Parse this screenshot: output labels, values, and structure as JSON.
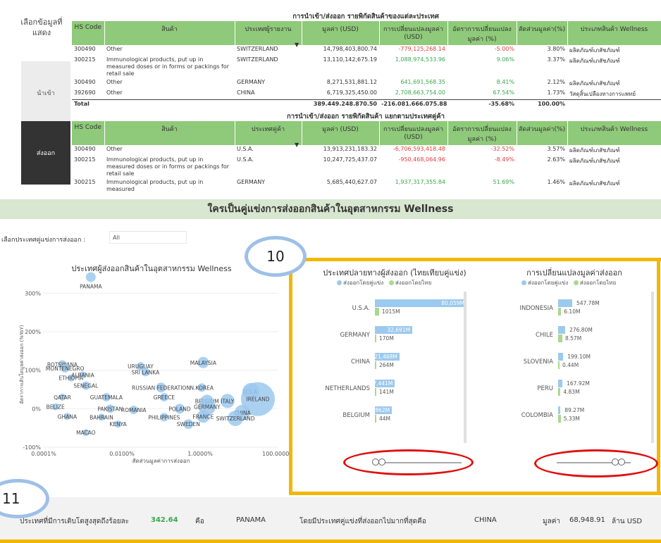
{
  "selector": {
    "title": "เลือกข้อมูลที่แสดง",
    "import_label": "นำเข้า",
    "export_label": "ส่งออก"
  },
  "table1": {
    "title": "การนำเข้า/ส่งออก รายพิกัดสินค้าของแต่ละประเทศ",
    "headers": [
      "HS Code",
      "สินค้า",
      "ประเทศผู้รายงาน",
      "มูลค่า (USD)",
      "การเปลี่ยนแปลงมูลค่า (USD)",
      "อัตราการเปลี่ยนแปลงมูลค่า (%)",
      "สัดส่วนมูลค่า(%)",
      "ประเภทสินค้า Wellness"
    ],
    "rows": [
      [
        "300490",
        "Other",
        "SWITZERLAND",
        "14,798,403,800.74",
        "-779,125,268.14",
        "-5.00%",
        "3.80%",
        "ผลิตภัณฑ์เภสัชภัณฑ์"
      ],
      [
        "300215",
        "Immunological products, put up in measured doses or in forms or packings for retail sale",
        "SWITZERLAND",
        "13,110,142,675.19",
        "1,088,974,533.96",
        "9.06%",
        "3.37%",
        "ผลิตภัณฑ์เภสัชภัณฑ์"
      ],
      [
        "300490",
        "Other",
        "GERMANY",
        "8,271,531,881.12",
        "641,691,568.35",
        "8.41%",
        "2.12%",
        "ผลิตภัณฑ์เภสัชภัณฑ์"
      ],
      [
        "392690",
        "Other",
        "CHINA",
        "6,719,325,450.00",
        "2,708,663,754.00",
        "67.54%",
        "1.73%",
        "วัสดุสิ้นเปลืองทางการแพทย์"
      ]
    ],
    "total": [
      "Total",
      "",
      "",
      "389,449,248,870.50",
      "-216,081,666,075.88",
      "-35.68%",
      "100.00%",
      ""
    ]
  },
  "table2": {
    "title": "การนำเข้า/ส่งออก รายพิกัดสินค้า แยกตามประเทศคู่ค้า",
    "headers": [
      "HS Code",
      "สินค้า",
      "ประเทศคู่ค้า",
      "มูลค่า (USD)",
      "การเปลี่ยนแปลงมูลค่า (USD)",
      "อัตราการเปลี่ยนแปลงมูลค่า (%)",
      "สัดส่วนมูลค่า(%)",
      "ประเภทสินค้า Wellness"
    ],
    "rows": [
      [
        "300490",
        "Other",
        "U.S.A.",
        "13,913,231,183.32",
        "-6,706,593,418.48",
        "-32.52%",
        "3.57%",
        "ผลิตภัณฑ์เภสัชภัณฑ์"
      ],
      [
        "300215",
        "Immunological products, put up in measured doses or in forms or packings for retail sale",
        "U.S.A.",
        "10,247,725,437.07",
        "-950,468,064.96",
        "-8.49%",
        "2.63%",
        "ผลิตภัณฑ์เภสัชภัณฑ์"
      ],
      [
        "300215",
        "Immunological products, put up in measured",
        "GERMANY",
        "5,685,440,627.07",
        "1,937,317,355.84",
        "51.69%",
        "1.46%",
        "ผลิตภัณฑ์เภสัชภัณฑ์"
      ]
    ],
    "total": [
      "Total",
      "",
      "",
      "389,449,248,870.49",
      "-216,081,666,075.89",
      "-35.68%",
      "100.00%",
      ""
    ]
  },
  "banner": "ใครเป็นคู่แข่งการส่งออกสินค้าในอุตสาหกรรม Wellness",
  "filter": {
    "label": "เลือกประเทศคู่แข่งการส่งออก :",
    "value": "All"
  },
  "badges": {
    "b10": "10",
    "b11": "11"
  },
  "scatter": {
    "title": "ประเทศผู้ส่งออกสินค้าในอุตสาหกรรม Wellness",
    "xlabel": "สัดส่วนมูลค่าการส่งออก",
    "ylabel": "อัตราการเติบโตมูลค่าส่งออก (%YoY)",
    "yticks": [
      "300%",
      "200%",
      "100%",
      "0%",
      "-100%"
    ],
    "xticks": [
      "0.0001%",
      "0.0100%",
      "1.0000%",
      "100.0000%"
    ],
    "points": [
      {
        "label": "PANAMA",
        "x": 0.0016,
        "y": 342,
        "r": 7
      },
      {
        "label": "BOTSWANA",
        "x": 0.0003,
        "y": 115,
        "r": 6
      },
      {
        "label": "MONTENEGRO",
        "x": 0.00035,
        "y": 105,
        "r": 6
      },
      {
        "label": "ETHIOPIA",
        "x": 0.0005,
        "y": 80,
        "r": 5
      },
      {
        "label": "ALBANIA",
        "x": 0.001,
        "y": 88,
        "r": 5
      },
      {
        "label": "URUGUAY",
        "x": 0.03,
        "y": 110,
        "r": 6
      },
      {
        "label": "SRI LANKA",
        "x": 0.04,
        "y": 95,
        "r": 6
      },
      {
        "label": "MALAYSIA",
        "x": 1.2,
        "y": 120,
        "r": 8
      },
      {
        "label": "SENEGAL",
        "x": 0.0012,
        "y": 60,
        "r": 6
      },
      {
        "label": "RUSSIAN FEDERATION",
        "x": 0.1,
        "y": 55,
        "r": 7
      },
      {
        "label": "N.KOREA",
        "x": 1.1,
        "y": 55,
        "r": 6
      },
      {
        "label": "U.S.A.",
        "x": 20,
        "y": 45,
        "r": 12
      },
      {
        "label": "QATAR",
        "x": 0.0003,
        "y": 30,
        "r": 5
      },
      {
        "label": "GUATEMALA",
        "x": 0.004,
        "y": 30,
        "r": 6
      },
      {
        "label": "GREECE",
        "x": 0.12,
        "y": 30,
        "r": 6
      },
      {
        "label": "BELGIUM",
        "x": 1.5,
        "y": 20,
        "r": 9
      },
      {
        "label": "ITALY",
        "x": 5,
        "y": 20,
        "r": 10
      },
      {
        "label": "IRELAND",
        "x": 30,
        "y": 25,
        "r": 24
      },
      {
        "label": "BELIZE",
        "x": 0.0002,
        "y": 5,
        "r": 5
      },
      {
        "label": "PAKISTAN",
        "x": 0.005,
        "y": 0,
        "r": 6
      },
      {
        "label": "ROMANIA",
        "x": 0.02,
        "y": -3,
        "r": 6
      },
      {
        "label": "POLAND",
        "x": 0.3,
        "y": 0,
        "r": 7
      },
      {
        "label": "GERMANY",
        "x": 1.5,
        "y": 5,
        "r": 12
      },
      {
        "label": "CHINA",
        "x": 12,
        "y": -10,
        "r": 11
      },
      {
        "label": "GHANA",
        "x": 0.0004,
        "y": -20,
        "r": 5
      },
      {
        "label": "BAHRAIN",
        "x": 0.003,
        "y": -22,
        "r": 5
      },
      {
        "label": "PHILIPPINES",
        "x": 0.12,
        "y": -22,
        "r": 6
      },
      {
        "label": "FRANCE",
        "x": 1.2,
        "y": -20,
        "r": 9
      },
      {
        "label": "SWITZERLAND",
        "x": 8,
        "y": -25,
        "r": 11
      },
      {
        "label": "KENYA",
        "x": 0.008,
        "y": -40,
        "r": 5
      },
      {
        "label": "SWEDEN",
        "x": 0.5,
        "y": -40,
        "r": 7
      },
      {
        "label": "MACAO",
        "x": 0.0012,
        "y": -62,
        "r": 5
      }
    ]
  },
  "destbar": {
    "title": "ประเทศปลายทางผู้ส่งออก (ไทยเทียบคู่แข่ง)",
    "legend_comp": "ส่งออกโดยคู่แข่ง",
    "legend_thai": "ส่งออกโดยไทย",
    "rows": [
      {
        "country": "U.S.A.",
        "comp": "80,059M",
        "thai": "1015M"
      },
      {
        "country": "GERMANY",
        "comp": "32,691M",
        "thai": "170M"
      },
      {
        "country": "CHINA",
        "comp": "21,468M",
        "thai": "264M"
      },
      {
        "country": "NETHERLANDS",
        "comp": "17,441M",
        "thai": "141M"
      },
      {
        "country": "BELGIUM",
        "comp": "14,862M",
        "thai": "44M"
      }
    ]
  },
  "changebar": {
    "title": "การเปลี่ยนแปลงมูลค่าส่งออก",
    "legend_comp": "ส่งออกโดยคู่แข่ง",
    "legend_thai": "ส่งออกโดยไทย",
    "rows": [
      {
        "country": "INDONESIA",
        "comp": "547.78M",
        "thai": "6.10M"
      },
      {
        "country": "CHILE",
        "comp": "276.80M",
        "thai": "8.57M"
      },
      {
        "country": "SLOVENIA",
        "comp": "199.10M",
        "thai": "0.44M"
      },
      {
        "country": "PERU",
        "comp": "167.92M",
        "thai": "4.83M"
      },
      {
        "country": "COLOMBIA",
        "comp": "89.27M",
        "thai": "5.33M"
      }
    ]
  },
  "bottom": {
    "p1": "ประเทศที่มีการเติบโตสูงสุดถึงร้อยละ",
    "growth": "342.64",
    "p2": "คือ",
    "country": "PANAMA",
    "p3": "โดยมีประเทศคู่แข่งที่ส่งออกไปมากที่สุดคือ",
    "top_comp": "CHINA",
    "p4": "มูลค่า",
    "value": "68,948.91",
    "unit": "ล้าน USD"
  },
  "colors": {
    "header_green": "#8fc97a",
    "accent_orange": "#f2b705",
    "bar_blue": "#9cc9ee",
    "bar_green": "#a7d98f",
    "highlight_red": "#e01010",
    "badge_blue": "#9ec0e8"
  }
}
